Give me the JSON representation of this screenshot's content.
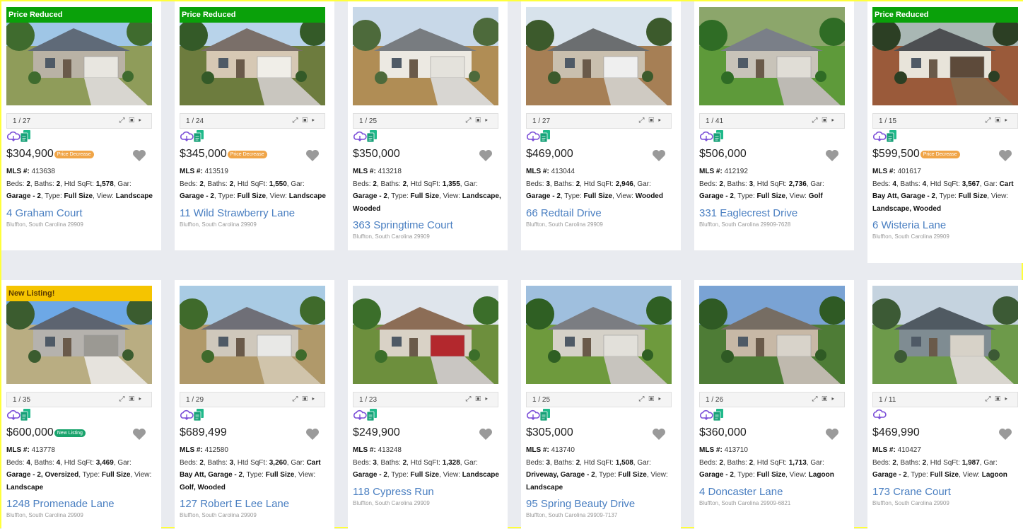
{
  "colors": {
    "price_reduced": "#0aa10a",
    "new_listing": "#f5c400",
    "street_link": "#4a7fc1",
    "frame": "#ffff3a"
  },
  "icons": {
    "cloud": "cloud-tour-icon",
    "docs": "documents-icon",
    "expand": "fullscreen-icon",
    "thumbs": "gallery-icon",
    "play": "play-icon",
    "favorite": "heart-icon"
  },
  "listings": [
    {
      "banner": "Price Reduced",
      "banner_type": "reduced",
      "photo_count": "1 / 27",
      "price": "$304,900",
      "badge": "Price Decrease",
      "badge_type": "reduced",
      "mls_label": "MLS #:",
      "mls": "413638",
      "beds": "2",
      "baths": "2",
      "sqft": "1,578",
      "garage": "Garage - 2",
      "type": "Full Size",
      "view": "Landscape",
      "street": "4 Graham Court",
      "city": "Bluffton, South Carolina 29909",
      "has_docs": true
    },
    {
      "banner": "Price Reduced",
      "banner_type": "reduced",
      "photo_count": "1 / 24",
      "price": "$345,000",
      "badge": "Price Decrease",
      "badge_type": "reduced",
      "mls_label": "MLS #:",
      "mls": "413519",
      "beds": "2",
      "baths": "2",
      "sqft": "1,550",
      "garage": "Garage - 2",
      "type": "Full Size",
      "view": "Landscape",
      "street": "11 Wild Strawberry Lane",
      "city": "Bluffton, South Carolina 29909",
      "has_docs": true
    },
    {
      "banner": "",
      "banner_type": "",
      "photo_count": "1 / 25",
      "price": "$350,000",
      "badge": "",
      "badge_type": "",
      "mls_label": "MLS #:",
      "mls": "413218",
      "beds": "2",
      "baths": "2",
      "sqft": "1,355",
      "garage": "Garage - 2",
      "type": "Full Size",
      "view": "Landscape, Wooded",
      "street": "363 Springtime Court",
      "city": "Bluffton, South Carolina 29909",
      "has_docs": true
    },
    {
      "banner": "",
      "banner_type": "",
      "photo_count": "1 / 27",
      "price": "$469,000",
      "badge": "",
      "badge_type": "",
      "mls_label": "MLS #:",
      "mls": "413044",
      "beds": "3",
      "baths": "2",
      "sqft": "2,946",
      "garage": "Garage - 2",
      "type": "Full Size",
      "view": "Wooded",
      "street": "66 Redtail Drive",
      "city": "Bluffton, South Carolina 29909",
      "has_docs": true
    },
    {
      "banner": "",
      "banner_type": "",
      "photo_count": "1 / 41",
      "price": "$506,000",
      "badge": "",
      "badge_type": "",
      "mls_label": "MLS #:",
      "mls": "412192",
      "beds": "2",
      "baths": "3",
      "sqft": "2,736",
      "garage": "Garage - 2",
      "type": "Full Size",
      "view": "Golf",
      "street": "331 Eaglecrest Drive",
      "city": "Bluffton, South Carolina 29909-7628",
      "has_docs": true
    },
    {
      "banner": "Price Reduced",
      "banner_type": "reduced",
      "photo_count": "1 / 15",
      "price": "$599,500",
      "badge": "Price Decrease",
      "badge_type": "reduced",
      "mls_label": "MLS #:",
      "mls": "401617",
      "beds": "4",
      "baths": "4",
      "sqft": "3,567",
      "garage": "Cart Bay Att, Garage - 2",
      "type": "Full Size",
      "view": "Landscape, Wooded",
      "street": "6 Wisteria Lane",
      "city": "Bluffton, South Carolina 29909",
      "has_docs": true
    },
    {
      "banner": "New Listing!",
      "banner_type": "new",
      "photo_count": "1 / 35",
      "price": "$600,000",
      "badge": "New Listing",
      "badge_type": "new",
      "mls_label": "MLS #:",
      "mls": "413778",
      "beds": "4",
      "baths": "4",
      "sqft": "3,469",
      "garage": "Garage - 2, Oversized",
      "type": "Full Size",
      "view": "Landscape",
      "street": "1248 Promenade Lane",
      "city": "Bluffton, South Carolina 29909",
      "has_docs": true
    },
    {
      "banner": "",
      "banner_type": "",
      "photo_count": "1 / 29",
      "price": "$689,499",
      "badge": "",
      "badge_type": "",
      "mls_label": "MLS #:",
      "mls": "412580",
      "beds": "2",
      "baths": "3",
      "sqft": "3,260",
      "garage": "Cart Bay Att, Garage - 2",
      "type": "Full Size",
      "view": "Golf, Wooded",
      "street": "127 Robert E Lee Lane",
      "city": "Bluffton, South Carolina 29909",
      "has_docs": true
    },
    {
      "banner": "",
      "banner_type": "",
      "photo_count": "1 / 23",
      "price": "$249,900",
      "badge": "",
      "badge_type": "",
      "mls_label": "MLS #:",
      "mls": "413248",
      "beds": "3",
      "baths": "2",
      "sqft": "1,328",
      "garage": "Garage - 2",
      "type": "Full Size",
      "view": "Landscape",
      "street": "118 Cypress Run",
      "city": "Bluffton, South Carolina 29909",
      "has_docs": true
    },
    {
      "banner": "",
      "banner_type": "",
      "photo_count": "1 / 25",
      "price": "$305,000",
      "badge": "",
      "badge_type": "",
      "mls_label": "MLS #:",
      "mls": "413740",
      "beds": "3",
      "baths": "2",
      "sqft": "1,508",
      "garage": "Driveway, Garage - 2",
      "type": "Full Size",
      "view": "Landscape",
      "street": "95 Spring Beauty Drive",
      "city": "Bluffton, South Carolina 29909-7137",
      "has_docs": true
    },
    {
      "banner": "",
      "banner_type": "",
      "photo_count": "1 / 26",
      "price": "$360,000",
      "badge": "",
      "badge_type": "",
      "mls_label": "MLS #:",
      "mls": "413710",
      "beds": "2",
      "baths": "2",
      "sqft": "1,713",
      "garage": "Garage - 2",
      "type": "Full Size",
      "view": "Lagoon",
      "street": "4 Doncaster Lane",
      "city": "Bluffton, South Carolina 29909-6821",
      "has_docs": true
    },
    {
      "banner": "",
      "banner_type": "",
      "photo_count": "1 / 11",
      "price": "$469,990",
      "badge": "",
      "badge_type": "",
      "mls_label": "MLS #:",
      "mls": "410427",
      "beds": "2",
      "baths": "2",
      "sqft": "1,987",
      "garage": "Garage - 2",
      "type": "Full Size",
      "view": "Lagoon",
      "street": "173 Crane Court",
      "city": "Bluffton, South Carolina 29909",
      "has_docs": false
    }
  ]
}
